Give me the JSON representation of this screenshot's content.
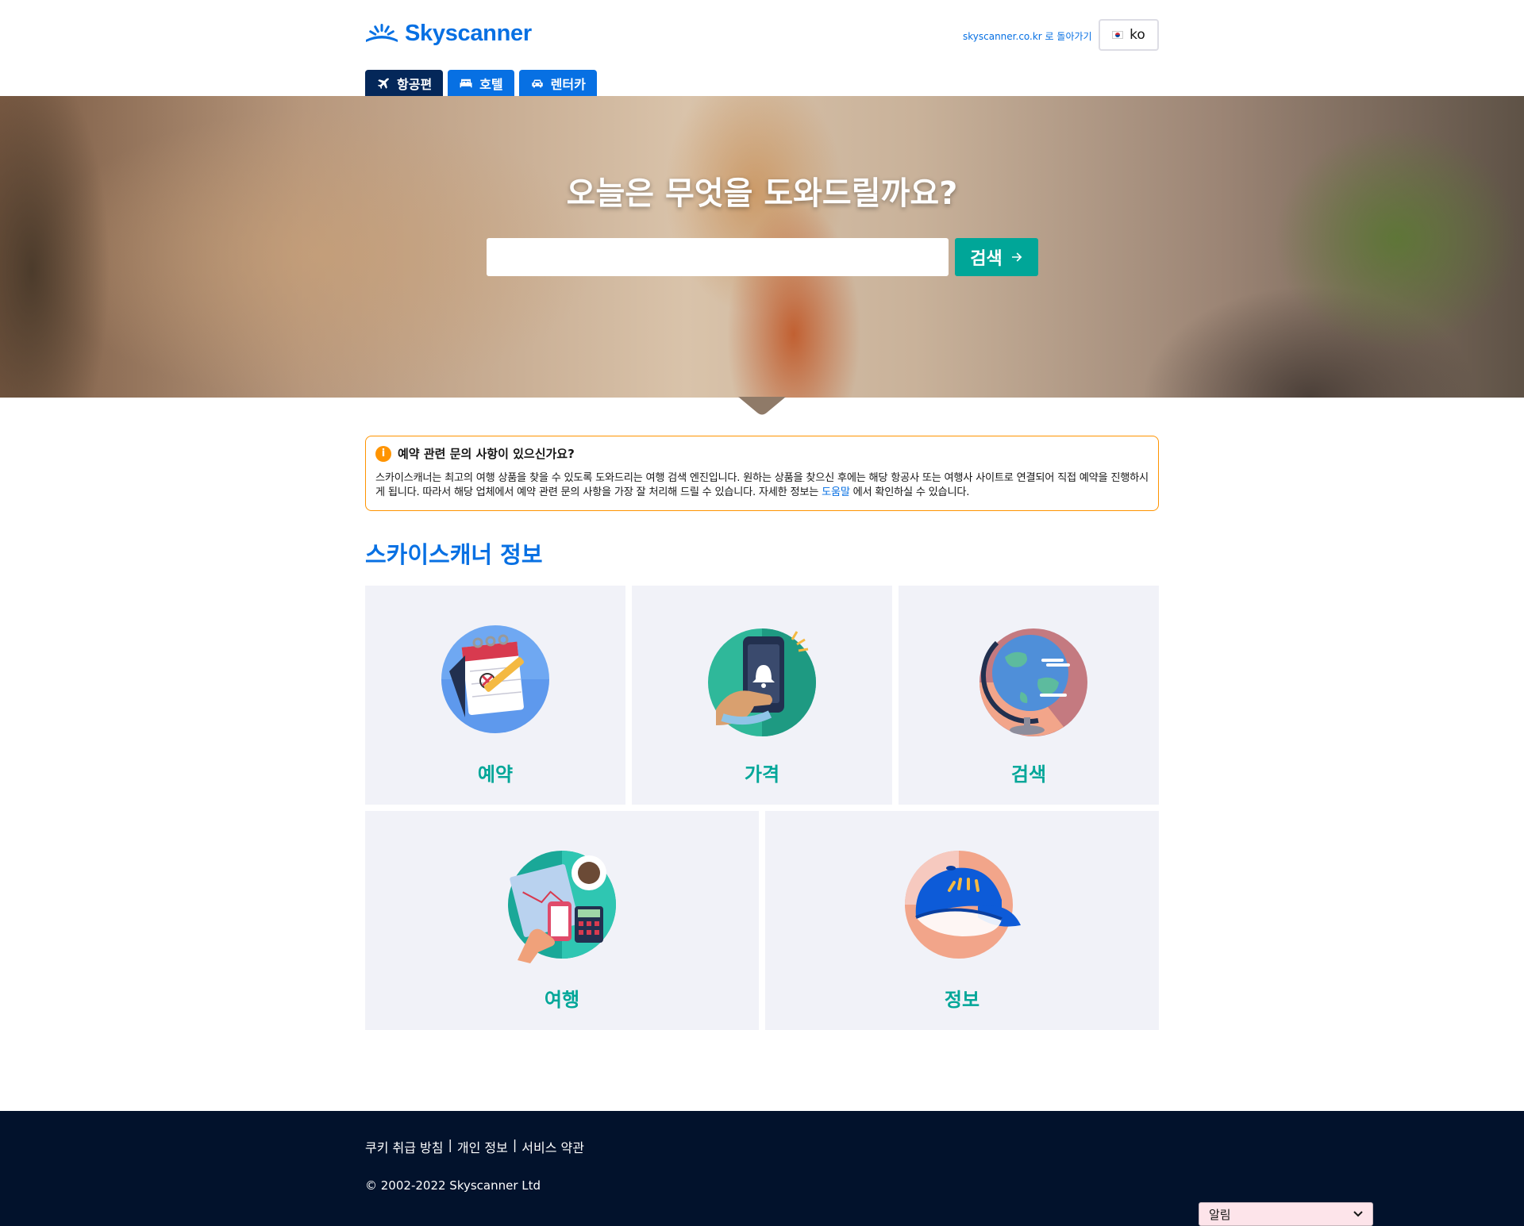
{
  "brand": {
    "name": "Skyscanner",
    "color": "#0770e3",
    "accent": "#00a698"
  },
  "header": {
    "back_link": "skyscanner.co.kr 로 돌아가기",
    "language": "ko"
  },
  "tabs": [
    {
      "label": "항공편",
      "icon": "plane-icon",
      "active": true
    },
    {
      "label": "호텔",
      "icon": "bed-icon",
      "active": false
    },
    {
      "label": "렌터카",
      "icon": "car-icon",
      "active": false
    }
  ],
  "hero": {
    "title": "오늘은 무엇을 도와드릴까요?",
    "search_value": "",
    "search_button": "검색"
  },
  "notice": {
    "title": "예약 관련 문의 사항이 있으신가요?",
    "body_before": "스카이스캐너는 최고의 여행 상품을 찾을 수 있도록 도와드리는 여행 검색 엔진입니다. 원하는 상품을 찾으신 후에는 해당 항공사 또는 여행사 사이트로 연결되어 직접 예약을 진행하시게 됩니다. 따라서 해당 업체에서 예약 관련 문의 사항을 가장 잘 처리해 드릴 수 있습니다. 자세한 정보는 ",
    "link": "도움말",
    "body_after": " 에서 확인하실 수 있습니다."
  },
  "section": {
    "title": "스카이스캐너 정보",
    "cards": [
      {
        "label": "예약",
        "icon": "calendar-icon"
      },
      {
        "label": "가격",
        "icon": "phone-alert-icon"
      },
      {
        "label": "검색",
        "icon": "globe-icon"
      },
      {
        "label": "여행",
        "icon": "travel-planning-icon"
      },
      {
        "label": "정보",
        "icon": "cap-icon"
      }
    ]
  },
  "footer": {
    "links": [
      "쿠키 취급 방침",
      "개인 정보",
      "서비스 약관"
    ],
    "separator": "|",
    "copyright": "© 2002-2022 Skyscanner Ltd",
    "alert_select": "알림"
  }
}
